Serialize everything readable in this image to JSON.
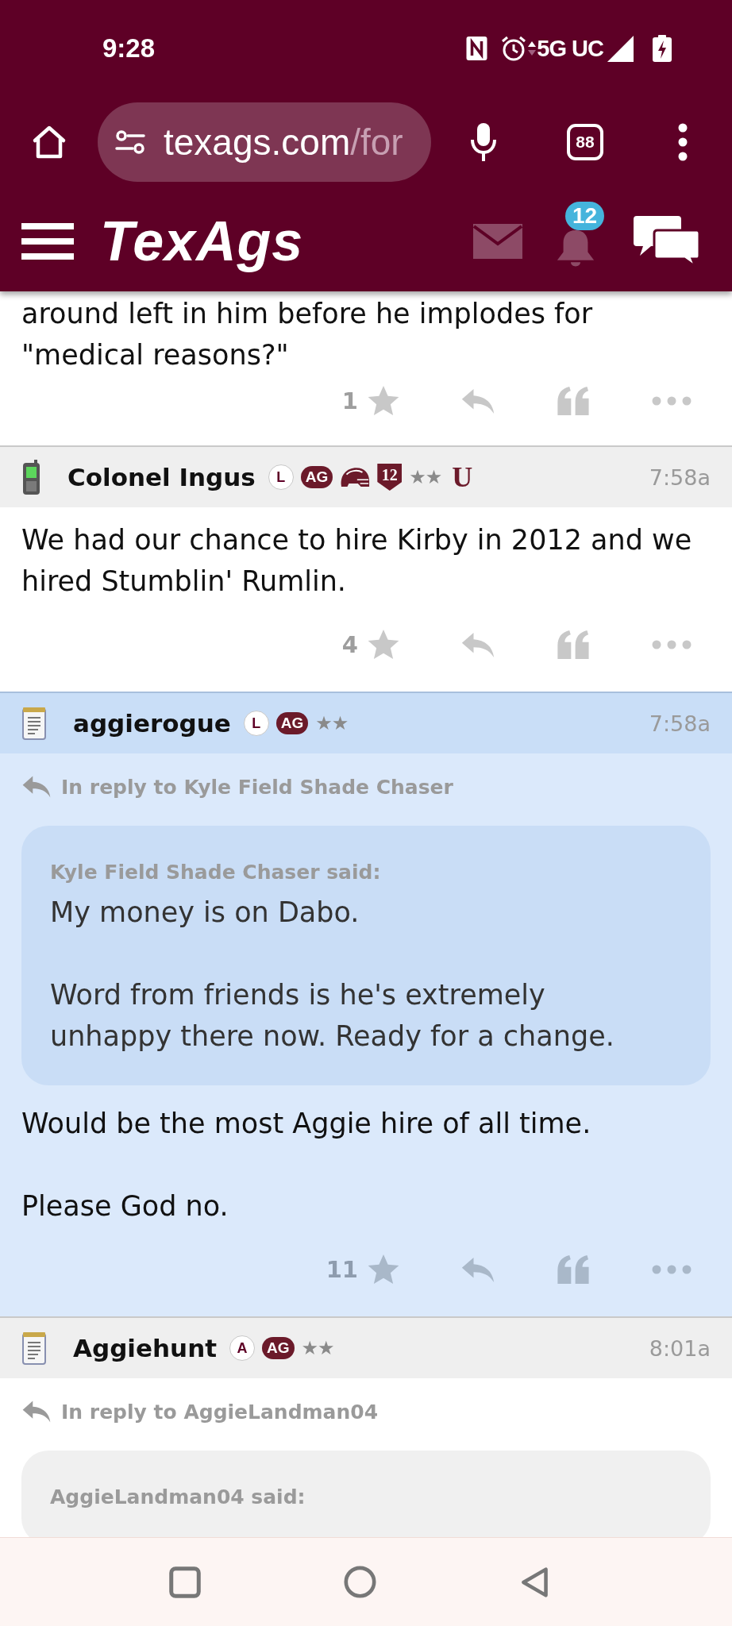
{
  "status_bar": {
    "time": "9:28",
    "network": "5G UC"
  },
  "browser": {
    "url_host": "texags.com",
    "url_path": "/for",
    "tab_count": "88"
  },
  "site_header": {
    "logo": "TexAgs",
    "notification_count": "12"
  },
  "posts": [
    {
      "highlighted": false,
      "body": [
        "around left in him before he implodes for \"medical reasons?\""
      ],
      "star_count": "1"
    },
    {
      "highlighted": false,
      "author": "Colonel Ingus",
      "avatar": {
        "kind": "phone"
      },
      "badges": [
        {
          "kind": "circle",
          "text": "L"
        },
        {
          "kind": "pill",
          "text": "AG"
        },
        {
          "kind": "helmet"
        },
        {
          "kind": "shield",
          "text": "12"
        },
        {
          "kind": "stars",
          "text": "★★"
        },
        {
          "kind": "letter",
          "text": "U"
        }
      ],
      "time": "7:58a",
      "body": [
        "We had our chance to hire Kirby in 2012 and we hired Stumblin' Rumlin."
      ],
      "star_count": "4"
    },
    {
      "highlighted": true,
      "author": "aggierogue",
      "avatar": {
        "kind": "notepad"
      },
      "badges": [
        {
          "kind": "circle",
          "text": "L"
        },
        {
          "kind": "pill",
          "text": "AG"
        },
        {
          "kind": "stars",
          "text": "★★"
        }
      ],
      "time": "7:58a",
      "reply_to": "In reply to Kyle Field Shade Chaser",
      "quote": {
        "author_line": "Kyle Field Shade Chaser said:",
        "paragraphs": [
          "My money is on Dabo.",
          "Word from friends is he's extremely unhappy there now. Ready for a change."
        ]
      },
      "body": [
        "Would be the most Aggie hire of all time.",
        "Please God no."
      ],
      "star_count": "11"
    },
    {
      "highlighted": false,
      "author": "Aggiehunt",
      "avatar": {
        "kind": "notepad"
      },
      "badges": [
        {
          "kind": "circle",
          "text": "A"
        },
        {
          "kind": "pill",
          "text": "AG"
        },
        {
          "kind": "stars",
          "text": "★★"
        }
      ],
      "time": "8:01a",
      "reply_to": "In reply to AggieLandman04",
      "quote": {
        "author_line": "AggieLandman04 said:"
      }
    }
  ]
}
